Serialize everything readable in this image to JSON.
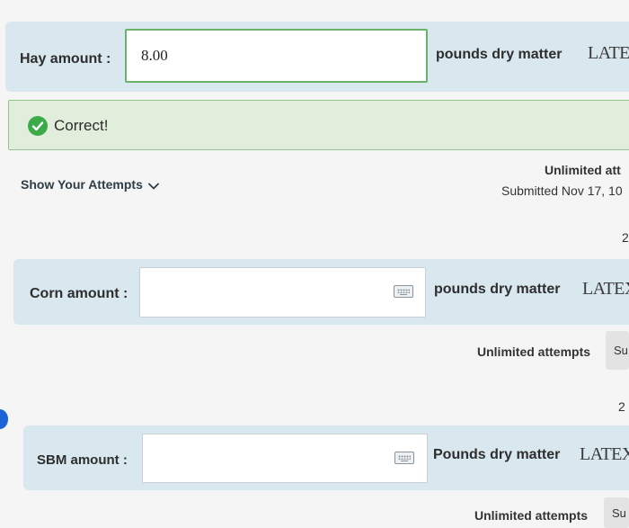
{
  "hay": {
    "label": "Hay amount :",
    "value": "8.00",
    "units": "pounds dry matter",
    "latex": "LATEX"
  },
  "feedback": {
    "message": "Correct!",
    "icon": "check-circle-icon",
    "color": "#3daa4a"
  },
  "attempts_section": {
    "toggle_label": "Show Your Attempts",
    "attempts_text": "Unlimited att",
    "submitted_text": "Submitted Nov 17, 10",
    "points": "2"
  },
  "corn": {
    "label": "Corn amount :",
    "value": "",
    "units": "pounds dry matter",
    "latex": "LATEX",
    "attempts_text": "Unlimited attempts",
    "submit_label": "Su",
    "points": "2"
  },
  "sbm": {
    "label": "SBM amount :",
    "value": "",
    "units": "Pounds dry matter",
    "latex": "LATEX",
    "attempts_text": "Unlimited attempts",
    "submit_label": "Su"
  },
  "colors": {
    "row_background": "#d9e7ef",
    "correct_border": "#8fc48a",
    "correct_background": "#e1eedb",
    "accent_blue": "#1c63d6"
  }
}
